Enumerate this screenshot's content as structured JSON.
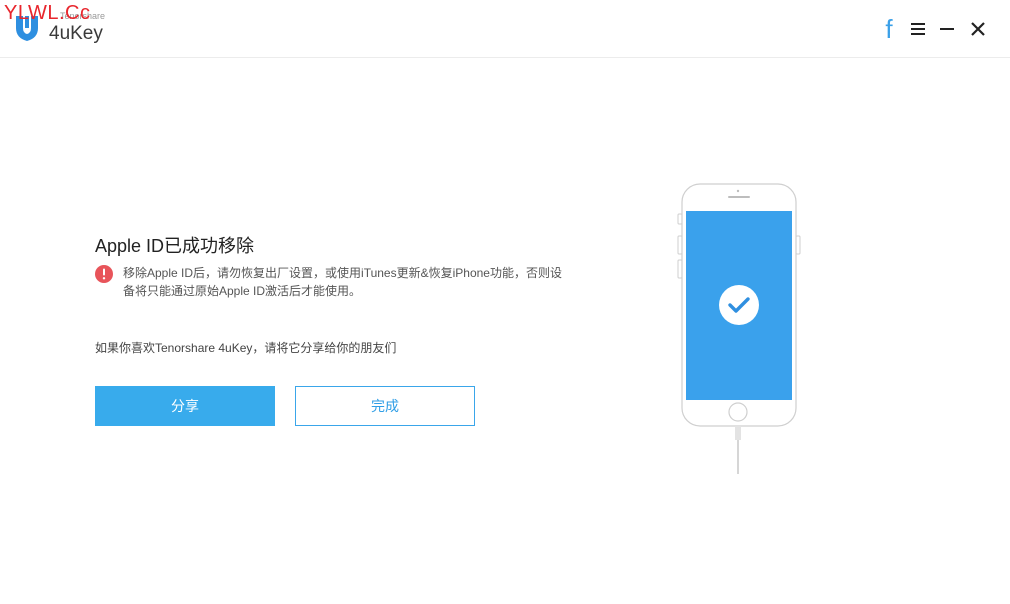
{
  "watermark": "YLWL.Cc",
  "brand": {
    "small_text": "Tenorshare",
    "name": "4uKey"
  },
  "window_controls": {
    "facebook": "f"
  },
  "main": {
    "title": "Apple ID已成功移除",
    "warning_text": "移除Apple ID后，请勿恢复出厂设置，或使用iTunes更新&恢复iPhone功能，否则设备将只能通过原始Apple ID激活后才能使用。",
    "share_prompt": "如果你喜欢Tenorshare 4uKey，请将它分享给你的朋友们",
    "share_button": "分享",
    "done_button": "完成"
  },
  "colors": {
    "accent": "#38abec",
    "warning": "#e8545a",
    "watermark": "#e8262d"
  }
}
